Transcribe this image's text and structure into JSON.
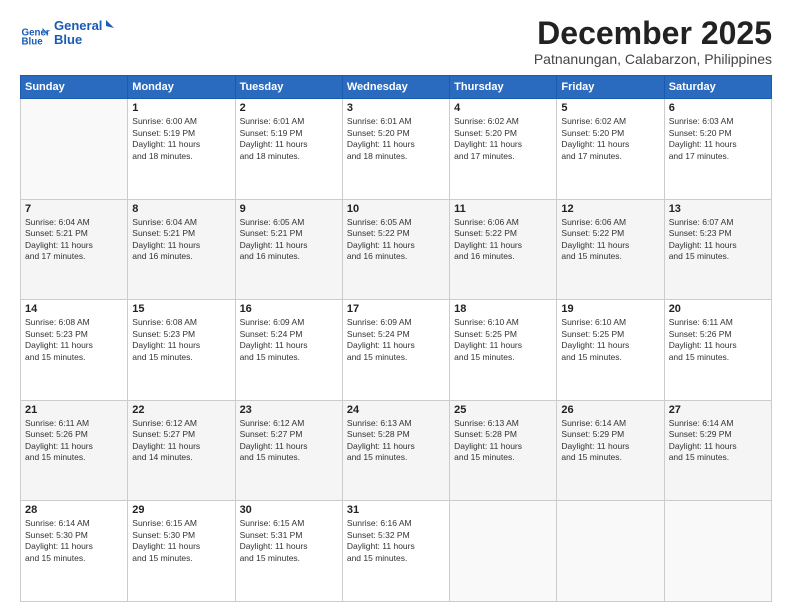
{
  "logo": {
    "line1": "General",
    "line2": "Blue"
  },
  "title": "December 2025",
  "subtitle": "Patnanungan, Calabarzon, Philippines",
  "header": {
    "days": [
      "Sunday",
      "Monday",
      "Tuesday",
      "Wednesday",
      "Thursday",
      "Friday",
      "Saturday"
    ]
  },
  "weeks": [
    [
      {
        "day": "",
        "info": ""
      },
      {
        "day": "1",
        "info": "Sunrise: 6:00 AM\nSunset: 5:19 PM\nDaylight: 11 hours\nand 18 minutes."
      },
      {
        "day": "2",
        "info": "Sunrise: 6:01 AM\nSunset: 5:19 PM\nDaylight: 11 hours\nand 18 minutes."
      },
      {
        "day": "3",
        "info": "Sunrise: 6:01 AM\nSunset: 5:20 PM\nDaylight: 11 hours\nand 18 minutes."
      },
      {
        "day": "4",
        "info": "Sunrise: 6:02 AM\nSunset: 5:20 PM\nDaylight: 11 hours\nand 17 minutes."
      },
      {
        "day": "5",
        "info": "Sunrise: 6:02 AM\nSunset: 5:20 PM\nDaylight: 11 hours\nand 17 minutes."
      },
      {
        "day": "6",
        "info": "Sunrise: 6:03 AM\nSunset: 5:20 PM\nDaylight: 11 hours\nand 17 minutes."
      }
    ],
    [
      {
        "day": "7",
        "info": "Sunrise: 6:04 AM\nSunset: 5:21 PM\nDaylight: 11 hours\nand 17 minutes."
      },
      {
        "day": "8",
        "info": "Sunrise: 6:04 AM\nSunset: 5:21 PM\nDaylight: 11 hours\nand 16 minutes."
      },
      {
        "day": "9",
        "info": "Sunrise: 6:05 AM\nSunset: 5:21 PM\nDaylight: 11 hours\nand 16 minutes."
      },
      {
        "day": "10",
        "info": "Sunrise: 6:05 AM\nSunset: 5:22 PM\nDaylight: 11 hours\nand 16 minutes."
      },
      {
        "day": "11",
        "info": "Sunrise: 6:06 AM\nSunset: 5:22 PM\nDaylight: 11 hours\nand 16 minutes."
      },
      {
        "day": "12",
        "info": "Sunrise: 6:06 AM\nSunset: 5:22 PM\nDaylight: 11 hours\nand 15 minutes."
      },
      {
        "day": "13",
        "info": "Sunrise: 6:07 AM\nSunset: 5:23 PM\nDaylight: 11 hours\nand 15 minutes."
      }
    ],
    [
      {
        "day": "14",
        "info": "Sunrise: 6:08 AM\nSunset: 5:23 PM\nDaylight: 11 hours\nand 15 minutes."
      },
      {
        "day": "15",
        "info": "Sunrise: 6:08 AM\nSunset: 5:23 PM\nDaylight: 11 hours\nand 15 minutes."
      },
      {
        "day": "16",
        "info": "Sunrise: 6:09 AM\nSunset: 5:24 PM\nDaylight: 11 hours\nand 15 minutes."
      },
      {
        "day": "17",
        "info": "Sunrise: 6:09 AM\nSunset: 5:24 PM\nDaylight: 11 hours\nand 15 minutes."
      },
      {
        "day": "18",
        "info": "Sunrise: 6:10 AM\nSunset: 5:25 PM\nDaylight: 11 hours\nand 15 minutes."
      },
      {
        "day": "19",
        "info": "Sunrise: 6:10 AM\nSunset: 5:25 PM\nDaylight: 11 hours\nand 15 minutes."
      },
      {
        "day": "20",
        "info": "Sunrise: 6:11 AM\nSunset: 5:26 PM\nDaylight: 11 hours\nand 15 minutes."
      }
    ],
    [
      {
        "day": "21",
        "info": "Sunrise: 6:11 AM\nSunset: 5:26 PM\nDaylight: 11 hours\nand 15 minutes."
      },
      {
        "day": "22",
        "info": "Sunrise: 6:12 AM\nSunset: 5:27 PM\nDaylight: 11 hours\nand 14 minutes."
      },
      {
        "day": "23",
        "info": "Sunrise: 6:12 AM\nSunset: 5:27 PM\nDaylight: 11 hours\nand 15 minutes."
      },
      {
        "day": "24",
        "info": "Sunrise: 6:13 AM\nSunset: 5:28 PM\nDaylight: 11 hours\nand 15 minutes."
      },
      {
        "day": "25",
        "info": "Sunrise: 6:13 AM\nSunset: 5:28 PM\nDaylight: 11 hours\nand 15 minutes."
      },
      {
        "day": "26",
        "info": "Sunrise: 6:14 AM\nSunset: 5:29 PM\nDaylight: 11 hours\nand 15 minutes."
      },
      {
        "day": "27",
        "info": "Sunrise: 6:14 AM\nSunset: 5:29 PM\nDaylight: 11 hours\nand 15 minutes."
      }
    ],
    [
      {
        "day": "28",
        "info": "Sunrise: 6:14 AM\nSunset: 5:30 PM\nDaylight: 11 hours\nand 15 minutes."
      },
      {
        "day": "29",
        "info": "Sunrise: 6:15 AM\nSunset: 5:30 PM\nDaylight: 11 hours\nand 15 minutes."
      },
      {
        "day": "30",
        "info": "Sunrise: 6:15 AM\nSunset: 5:31 PM\nDaylight: 11 hours\nand 15 minutes."
      },
      {
        "day": "31",
        "info": "Sunrise: 6:16 AM\nSunset: 5:32 PM\nDaylight: 11 hours\nand 15 minutes."
      },
      {
        "day": "",
        "info": ""
      },
      {
        "day": "",
        "info": ""
      },
      {
        "day": "",
        "info": ""
      }
    ]
  ]
}
